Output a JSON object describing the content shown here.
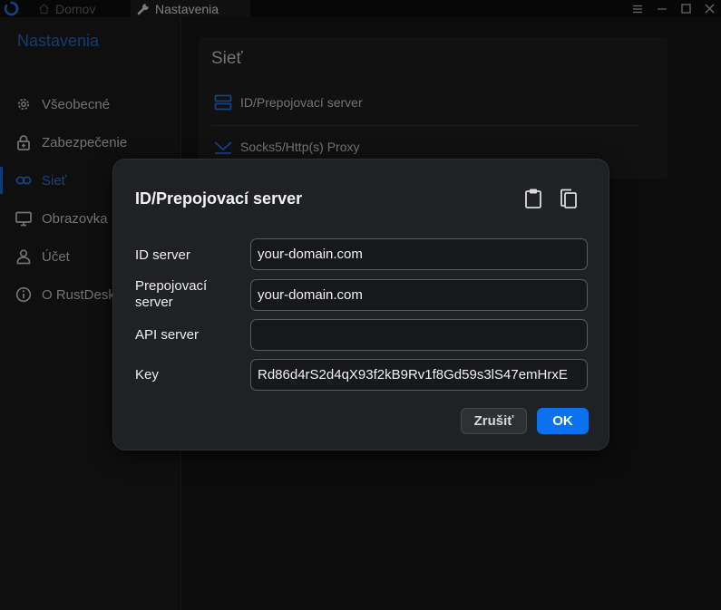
{
  "titlebar": {
    "tabs": [
      {
        "label": "Domov",
        "icon": "home-icon"
      },
      {
        "label": "Nastavenia",
        "icon": "wrench-icon"
      }
    ],
    "controls": [
      "menu-icon",
      "minimize-icon",
      "maximize-icon",
      "close-icon"
    ]
  },
  "sidebar": {
    "title": "Nastavenia",
    "items": [
      {
        "label": "Všeobecné",
        "icon": "gear-icon"
      },
      {
        "label": "Zabezpečenie",
        "icon": "lock-icon"
      },
      {
        "label": "Sieť",
        "icon": "link-icon",
        "active": true
      },
      {
        "label": "Obrazovka",
        "icon": "monitor-icon"
      },
      {
        "label": "Účet",
        "icon": "user-icon"
      },
      {
        "label": "O RustDesk",
        "icon": "info-icon"
      }
    ]
  },
  "network": {
    "title": "Sieť",
    "rows": [
      {
        "label": "ID/Prepojovací server",
        "icon": "server-icon"
      },
      {
        "label": "Socks5/Http(s) Proxy",
        "icon": "proxy-icon"
      }
    ]
  },
  "dialog": {
    "title": "ID/Prepojovací server",
    "fields": [
      {
        "label": "ID server",
        "value": "your-domain.com"
      },
      {
        "label": "Prepojovací server",
        "value": "your-domain.com"
      },
      {
        "label": "API server",
        "value": ""
      },
      {
        "label": "Key",
        "value": "Rd86d4rS2d4qX93f2kB9Rv1f8Gd59s3lS47emHrxE"
      }
    ],
    "cancel_label": "Zrušiť",
    "ok_label": "OK"
  },
  "colors": {
    "accent": "#1f6cd6",
    "ok_button": "#0b71f0",
    "dialog_bg": "#202124"
  }
}
